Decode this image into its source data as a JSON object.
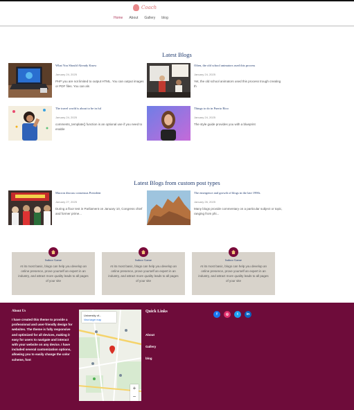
{
  "header": {
    "logo_text": "Coach",
    "nav": [
      {
        "label": "Home",
        "active": true
      },
      {
        "label": "About",
        "active": false
      },
      {
        "label": "Gallery",
        "active": false
      },
      {
        "label": "blog",
        "active": false
      }
    ]
  },
  "latest_blogs": {
    "title": "Latest Blogs",
    "posts": [
      {
        "title": "What You Should Already Know",
        "date": "January 24, 2025",
        "excerpt": "PHP you are not limited to output HTML. You can output images or PDF files. You can als",
        "image": "laptop-icon"
      },
      {
        "title": "Often, the old school animators used this process",
        "date": "January 24, 2025",
        "excerpt": "Yet, the old school animators used this process trough creating th",
        "image": "presentation-icon"
      },
      {
        "title": "The travel world is about to be in ful",
        "date": "January 24, 2025",
        "excerpt": "comments_template() function is an optional use if you need to enable",
        "image": "celebration-icon"
      },
      {
        "title": "Things to do in Puerto Rico",
        "date": "January 24, 2025",
        "excerpt": "The style guide provides you with a blueprint",
        "image": "portrait-icon"
      }
    ]
  },
  "custom_blogs": {
    "title": "Latest Blogs from custom post types",
    "posts": [
      {
        "title": "Macron discuss consensus President",
        "date": "January 27, 2025",
        "excerpt": "During a floor test in Parliament on January 10, Congress chief and former prime...",
        "image": "crowd-icon"
      },
      {
        "title": "The emergence and growth of blogs in the late 1990s",
        "date": "January 26, 2025",
        "excerpt": "Many blogs provide commentary on a particular subject or topic, ranging from phi...",
        "image": "rock-formation-icon"
      }
    ]
  },
  "cards": [
    {
      "title": "Indoor Game",
      "text": "At its most basic, blogs can help you develop an online presence, prove yourself an expert in an industry, and attract more quality leads to all pages of your site",
      "icon": "home-icon"
    },
    {
      "title": "Indoor Game",
      "text": "At its most basic, blogs can help you develop an online presence, prove yourself an expert in an industry, and attract more quality leads to all pages of your site",
      "icon": "home-icon"
    },
    {
      "title": "Indoor Game",
      "text": "At its most basic, blogs can help you develop an online presence, prove yourself an expert in an industry, and attract more quality leads to all pages of your site",
      "icon": "home-icon"
    }
  ],
  "footer": {
    "about_title": "About Us",
    "about_text": "I have created this theme to provide a professional and user-friendly design for websites. The theme is fully responsive and optimized for all devices, making it easy for users to navigate and interact with your website on any device. I have included several customization options, allowing you to easily change the color scheme, font",
    "map": {
      "place": "University of...",
      "link": "View larger map",
      "marker_label": "University of Oxford",
      "zoom_in": "+",
      "zoom_out": "−"
    },
    "links_title": "Quick Links",
    "links": [
      "About",
      "Gallery",
      "blog"
    ],
    "socials": [
      {
        "name": "facebook-icon",
        "glyph": "f",
        "color": "#1877f2"
      },
      {
        "name": "instagram-icon",
        "glyph": "◎",
        "color": "#e1306c"
      },
      {
        "name": "twitter-icon",
        "glyph": "t",
        "color": "#1da1f2"
      },
      {
        "name": "linkedin-icon",
        "glyph": "in",
        "color": "#0a66c2"
      }
    ]
  },
  "colors": {
    "footer_bg": "#6e0c3a",
    "heading": "#1f3a6e",
    "card_bg": "#d8d3cb",
    "accent": "#b04060"
  }
}
